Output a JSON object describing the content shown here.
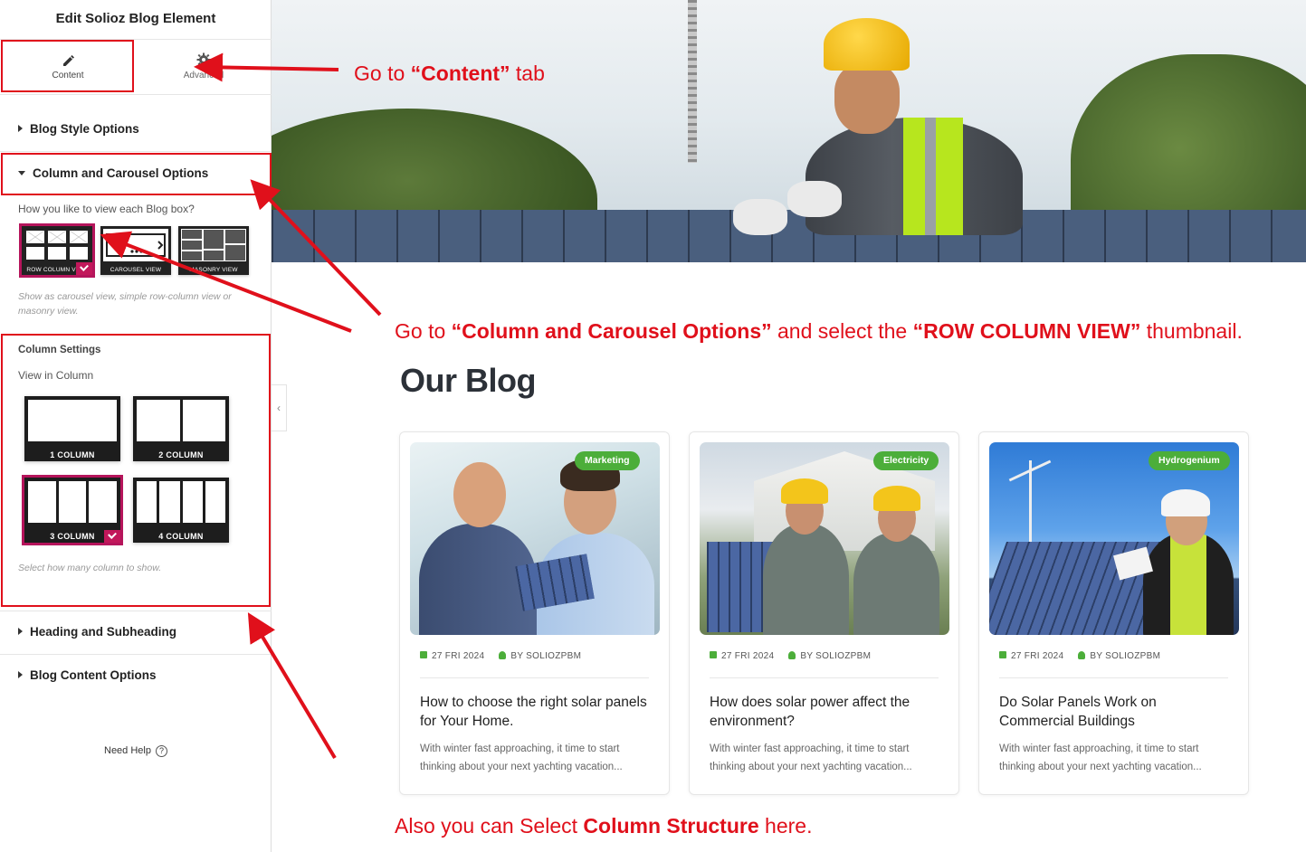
{
  "sidebar": {
    "title": "Edit Solioz Blog Element",
    "tabs": [
      {
        "label": "Content",
        "icon": "pencil-icon"
      },
      {
        "label": "Advanced",
        "icon": "gear-icon"
      }
    ],
    "sections": {
      "blog_style": "Blog Style Options",
      "column_carousel": "Column and Carousel Options",
      "heading_subheading": "Heading and Subheading",
      "blog_content": "Blog Content Options"
    },
    "view_prompt": "How you like to view each Blog box?",
    "view_options": [
      {
        "label": "ROW COLUMN VIEW",
        "selected": true
      },
      {
        "label": "CAROUSEL VIEW",
        "selected": false
      },
      {
        "label": "MASONRY VIEW",
        "selected": false
      }
    ],
    "view_hint": "Show as carousel view, simple row-column view or masonry view.",
    "column_settings_label": "Column Settings",
    "view_in_column_label": "View in Column",
    "column_options": [
      {
        "label": "1 COLUMN",
        "cols": 1,
        "selected": false
      },
      {
        "label": "2 COLUMN",
        "cols": 2,
        "selected": false
      },
      {
        "label": "3 COLUMN",
        "cols": 3,
        "selected": true
      },
      {
        "label": "4 COLUMN",
        "cols": 4,
        "selected": false
      }
    ],
    "column_hint": "Select how many column to show.",
    "need_help": "Need Help",
    "collapse_icon": "chevron-left-icon"
  },
  "annotations": {
    "content_tab_a": "Go  to ",
    "content_tab_b": "“Content”",
    "content_tab_c": " tab",
    "row_view_a": "Go to ",
    "row_view_b": "“Column and Carousel Options”",
    "row_view_c": " and select the ",
    "row_view_d": "“ROW COLUMN VIEW”",
    "row_view_e": " thumbnail.",
    "column_a": "Also you can Select ",
    "column_b": "Column Structure",
    "column_c": " here.",
    "color": "#e0101b"
  },
  "blog": {
    "heading": "Our Blog",
    "posts": [
      {
        "category": "Marketing",
        "date": "27 FRI 2024",
        "author": "BY SOLIOZPBM",
        "title": "How to choose the right solar panels for Your Home.",
        "excerpt": "With winter fast approaching, it time to start thinking about your next yachting vacation..."
      },
      {
        "category": "Electricity",
        "date": "27 FRI 2024",
        "author": "BY SOLIOZPBM",
        "title": "How does solar power affect the environment?",
        "excerpt": "With winter fast approaching, it time to start thinking about your next yachting vacation..."
      },
      {
        "category": "Hydrogenium",
        "date": "27 FRI 2024",
        "author": "BY SOLIOZPBM",
        "title": "Do Solar Panels Work on Commercial Buildings",
        "excerpt": "With winter fast approaching, it time to start thinking about your next yachting vacation..."
      }
    ],
    "badge_color": "#4cae3a"
  }
}
